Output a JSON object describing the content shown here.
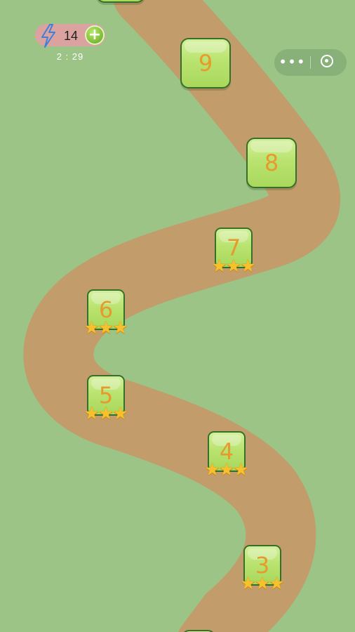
{
  "hud": {
    "energy_icon": "lightning-bolt-icon",
    "energy_count": "14",
    "add_icon": "plus-icon",
    "timer": "2 : 29"
  },
  "capsule": {
    "more_icon": "more-dots-icon",
    "close_icon": "target-close-icon"
  },
  "colors": {
    "background": "#9cc487",
    "path": "#c29c6a",
    "level_fill": "#b9e36f",
    "level_border": "#356f2a",
    "number": "#e69a2e",
    "star": "#f6c12d",
    "energy_pill": "#dba3a0"
  },
  "levels": [
    {
      "number": "9",
      "state": "locked",
      "stars": 0
    },
    {
      "number": "8",
      "state": "locked",
      "stars": 0
    },
    {
      "number": "7",
      "state": "completed",
      "stars": 3
    },
    {
      "number": "6",
      "state": "completed",
      "stars": 3
    },
    {
      "number": "5",
      "state": "completed",
      "stars": 3
    },
    {
      "number": "4",
      "state": "completed",
      "stars": 3
    },
    {
      "number": "3",
      "state": "completed",
      "stars": 3
    }
  ],
  "star_glyph": "★"
}
